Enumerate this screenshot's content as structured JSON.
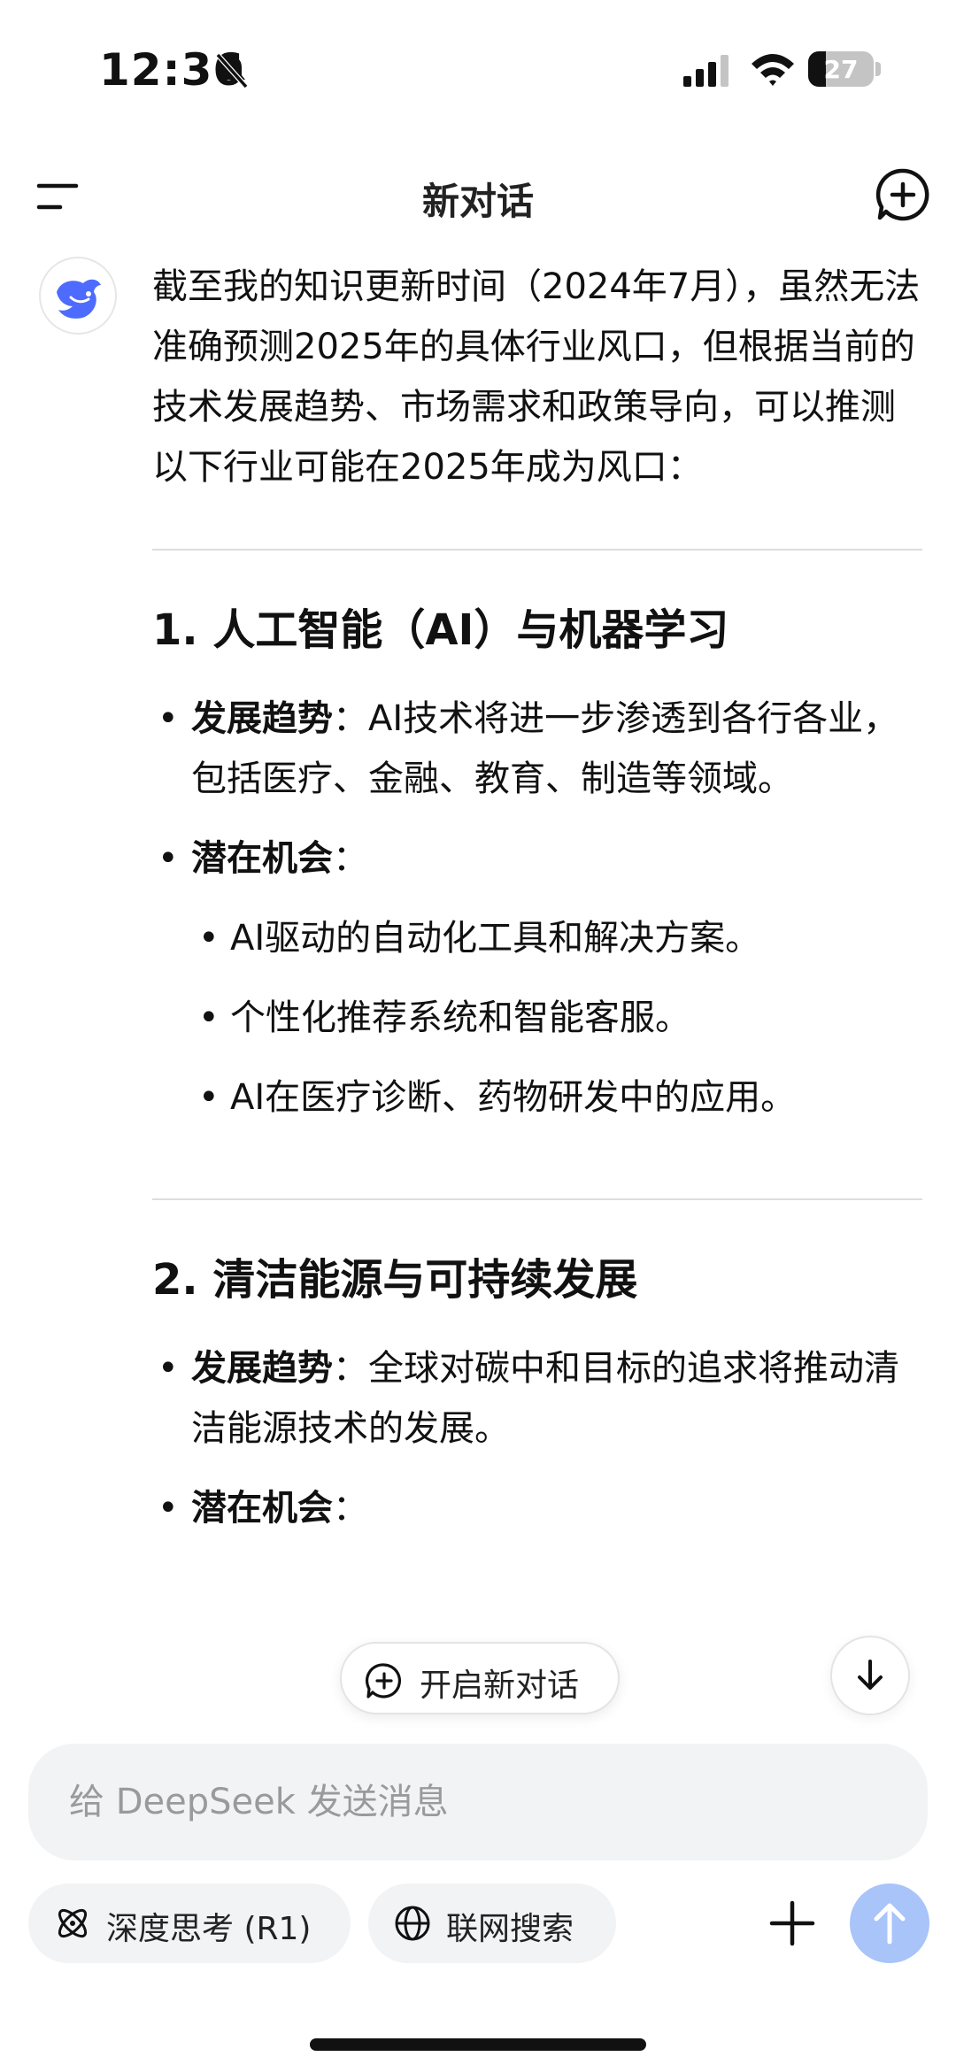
{
  "status_bar": {
    "time": "12:36",
    "battery": "27",
    "battery_level": 0.27
  },
  "header": {
    "title": "新对话"
  },
  "message": {
    "intro": "截至我的知识更新时间（2024年7月），虽然无法准确预测2025年的具体行业风口，但根据当前的技术发展趋势、市场需求和政策导向，可以推测以下行业可能在2025年成为风口：",
    "sections": [
      {
        "title": "1. 人工智能（AI）与机器学习",
        "trend_label": "发展趋势",
        "trend_text": "：AI技术将进一步渗透到各行各业，包括医疗、金融、教育、制造等领域。",
        "opportunity_label": "潜在机会",
        "opportunity_suffix": "：",
        "opportunities": [
          "AI驱动的自动化工具和解决方案。",
          "个性化推荐系统和智能客服。",
          "AI在医疗诊断、药物研发中的应用。"
        ]
      },
      {
        "title": "2. 清洁能源与可持续发展",
        "trend_label": "发展趋势",
        "trend_text": "：全球对碳中和目标的追求将推动清洁能源技术的发展。",
        "opportunity_label": "潜在机会",
        "opportunity_suffix": "："
      }
    ]
  },
  "floating": {
    "new_chat_label": "开启新对话"
  },
  "composer": {
    "placeholder": "给 DeepSeek 发送消息",
    "value": ""
  },
  "toolbar": {
    "deep_think_label": "深度思考 (R1)",
    "web_search_label": "联网搜索"
  },
  "colors": {
    "brand": "#4d6bfe",
    "send_button": "#a8c4f8",
    "input_bg": "#f2f3f5"
  },
  "icons": [
    "mute-icon",
    "signal-icon",
    "wifi-icon",
    "menu-icon",
    "new-chat-icon",
    "deepseek-logo-icon",
    "add-chat-icon",
    "arrow-down-icon",
    "atom-icon",
    "globe-icon",
    "plus-icon",
    "arrow-up-icon"
  ]
}
